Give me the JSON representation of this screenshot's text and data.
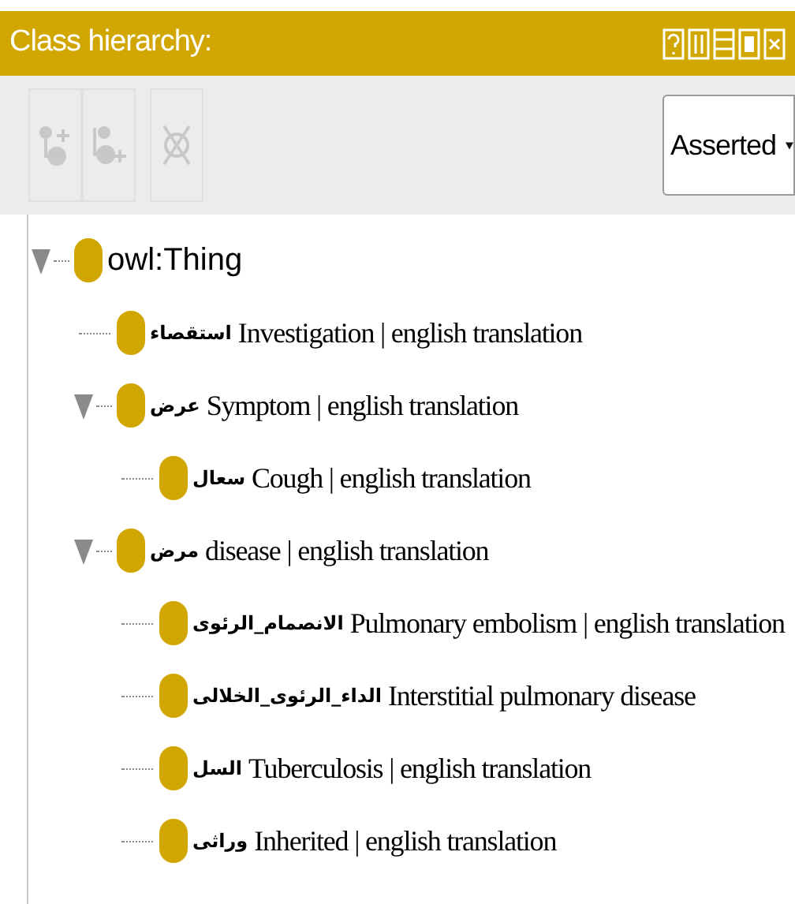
{
  "panel": {
    "title": "Class hierarchy:"
  },
  "toolbar": {
    "buttons": [
      {
        "kind": "add-sub",
        "disabled": true
      },
      {
        "kind": "add-sibling",
        "disabled": true
      },
      {
        "kind": "delete",
        "disabled": true
      }
    ],
    "view_dropdown": {
      "value": "Asserted"
    }
  },
  "tree": [
    {
      "label": "owl:Thing",
      "kind": "root",
      "expanded": true,
      "children": [
        {
          "arabic": "استقصاء",
          "label": "Investigation | english translation"
        },
        {
          "arabic": "عرض",
          "label": "Symptom | english translation",
          "expanded": true,
          "children": [
            {
              "arabic": "سعال",
              "label": "Cough | english translation"
            }
          ]
        },
        {
          "arabic": "مرض",
          "label": "disease | english translation",
          "expanded": true,
          "children": [
            {
              "arabic": "الانصمام_الرئوى",
              "label": "Pulmonary embolism | english translation"
            },
            {
              "arabic": "الداء_الرئوى_الخلالى",
              "label": "Interstitial pulmonary disease"
            },
            {
              "arabic": "السل",
              "label": "Tuberculosis | english translation"
            },
            {
              "arabic": "وراثى",
              "label": "Inherited | english translation"
            }
          ]
        }
      ]
    }
  ]
}
